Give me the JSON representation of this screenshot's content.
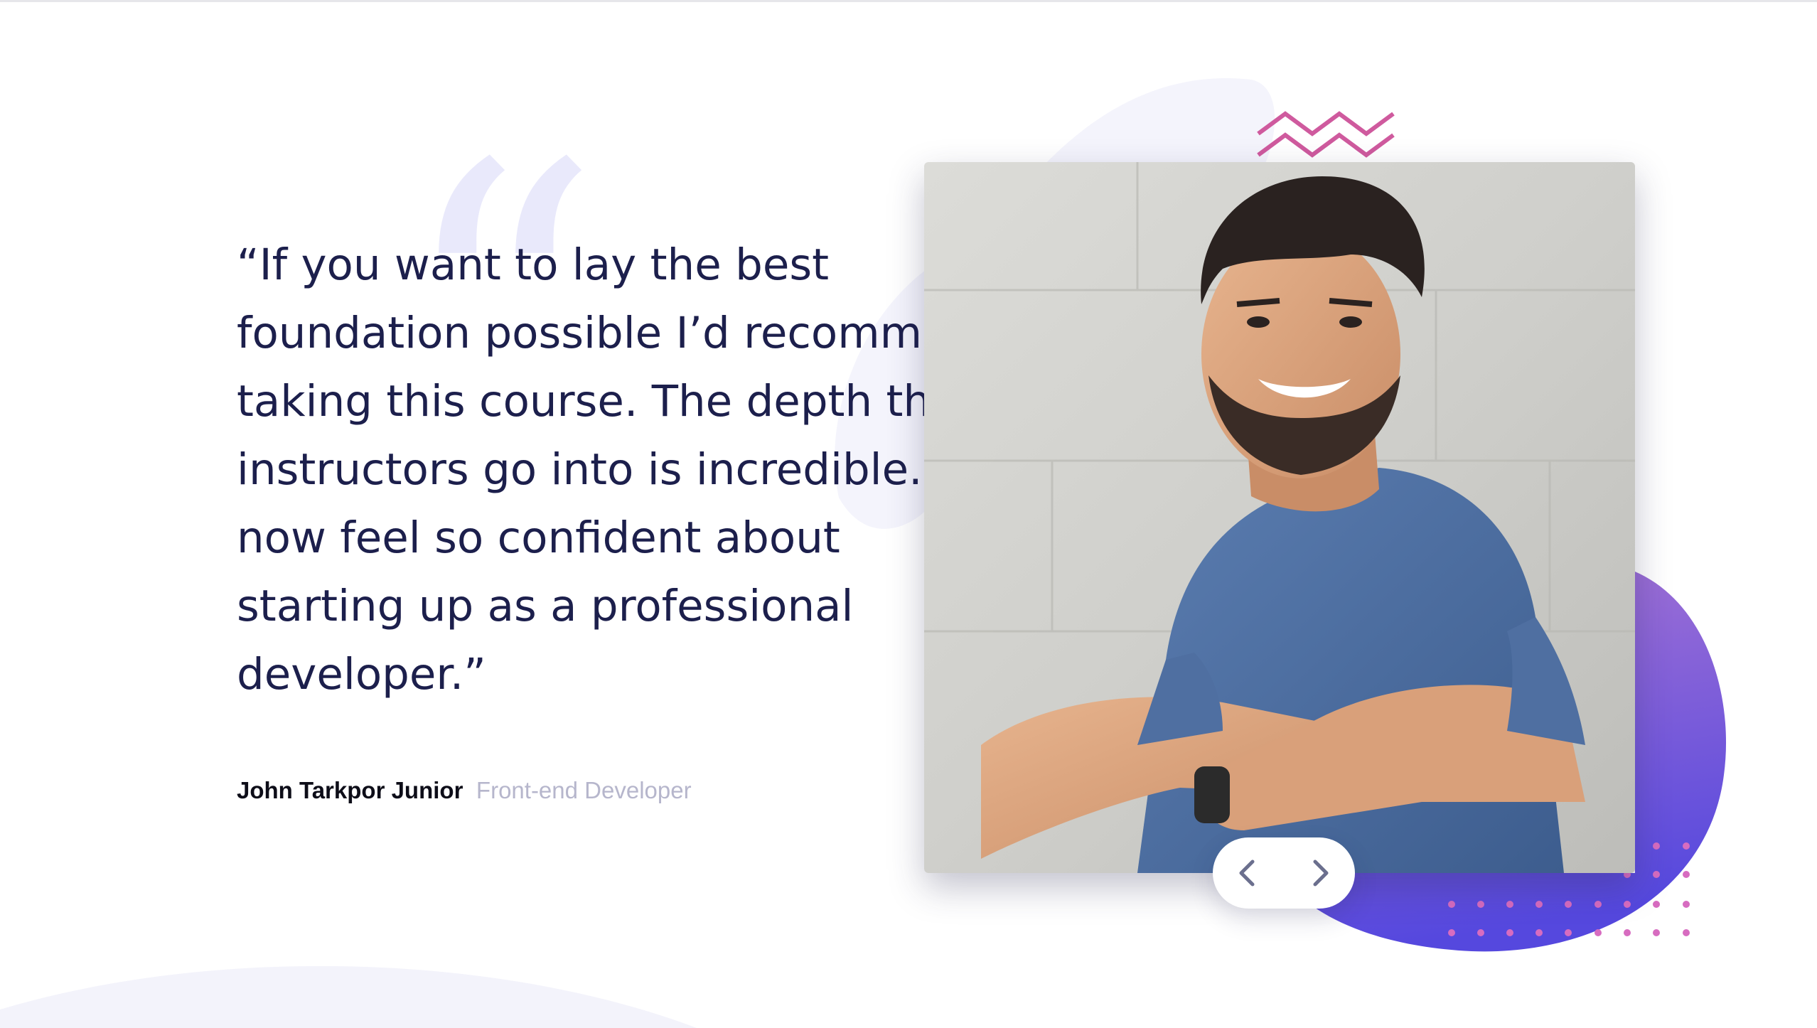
{
  "testimonial": {
    "quote": "“If you want to lay the best foundation possible I’d recommend taking this course. The depth the instructors go into is incredible. I now feel so confident about starting up as a professional developer.”",
    "author_name": "John Tarkpor Junior",
    "author_role": "Front-end Developer"
  },
  "navigation": {
    "prev_icon": "chevron-left-icon",
    "next_icon": "chevron-right-icon"
  },
  "decorations": {
    "quote_mark": "“",
    "zigzag_icon": "zigzag-pattern-icon",
    "dots_icon": "dot-grid-pattern-icon"
  },
  "colors": {
    "text_dark": "#1c1f4c",
    "author_role": "#b6b6cc",
    "accent_pink": "#cf5a9e",
    "gradient_start": "#9f6fd6",
    "gradient_end": "#5a4fe0",
    "blob_light": "#f4f4fc"
  }
}
